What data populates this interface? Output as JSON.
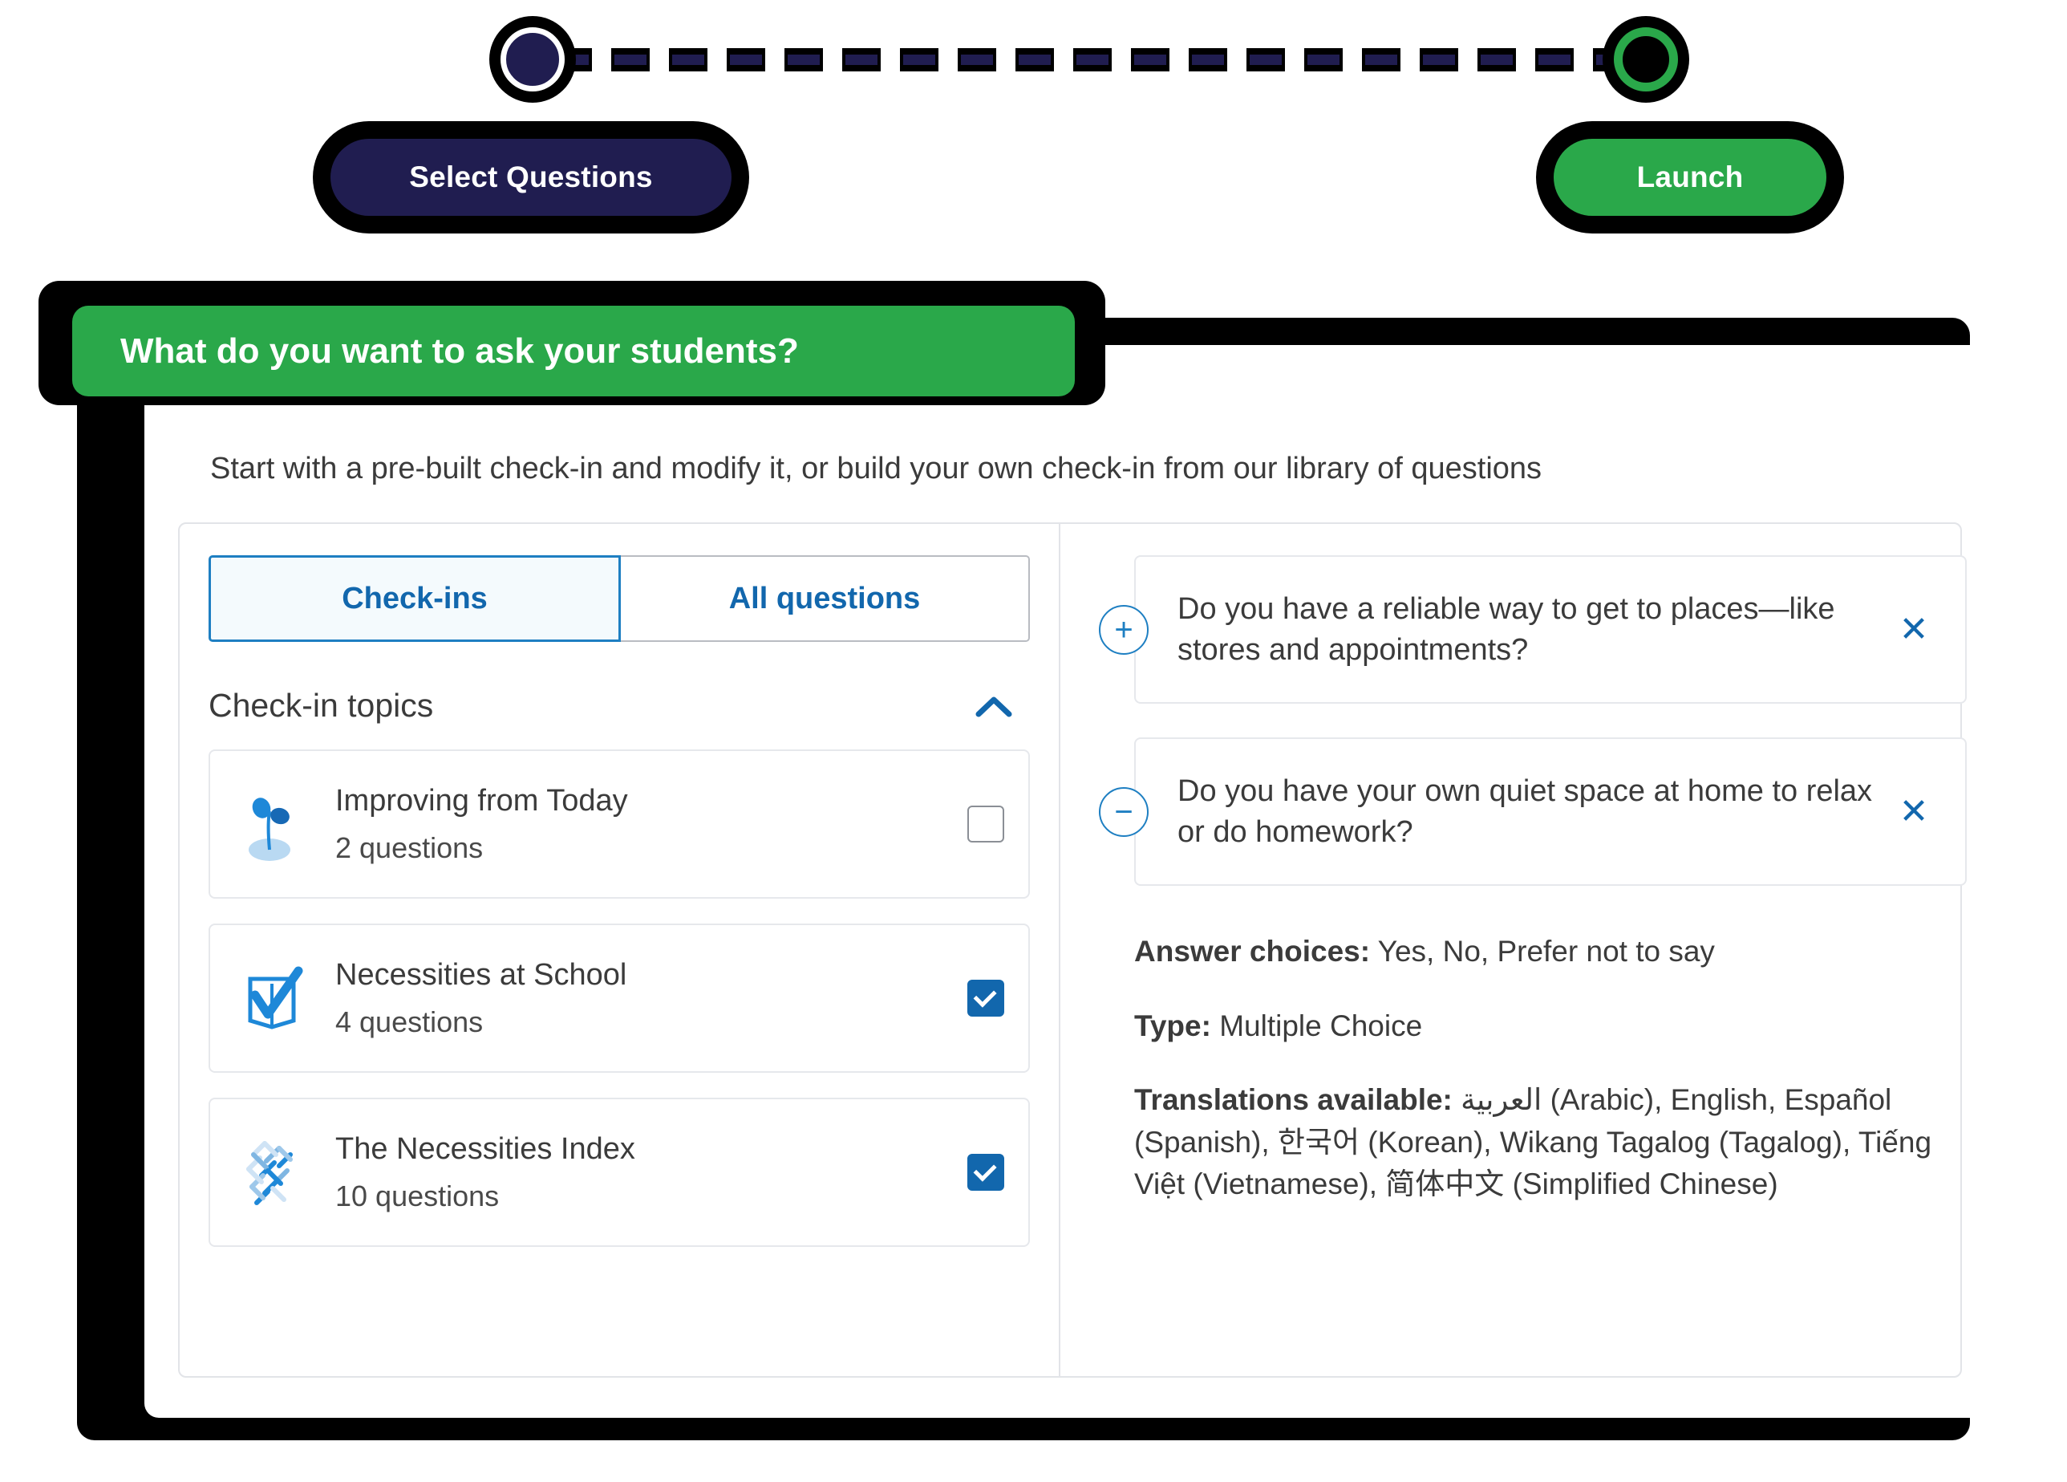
{
  "stepper": {
    "steps": [
      {
        "label": "Select Questions",
        "state": "current",
        "color": "#201d50"
      },
      {
        "label": "Launch",
        "state": "upcoming",
        "color": "#2aa84a"
      }
    ]
  },
  "header": {
    "pill_title": "What do you want to ask your students?",
    "pill_color": "#2aa84a",
    "subtitle": "Start with a pre-built check-in and modify it, or build your own check-in from our library of questions"
  },
  "left_panel": {
    "tabs": [
      {
        "label": "Check-ins",
        "active": true
      },
      {
        "label": "All questions",
        "active": false
      }
    ],
    "section": {
      "label": "Check-in topics",
      "collapse_icon": "chevron-up-icon",
      "expanded": true
    },
    "topics": [
      {
        "icon": "seedling-icon",
        "title": "Improving from Today",
        "count": "2 questions",
        "checked": false
      },
      {
        "icon": "book-check-icon",
        "title": "Necessities at School",
        "count": "4 questions",
        "checked": true
      },
      {
        "icon": "woven-diamond-icon",
        "title": "The Necessities Index",
        "count": "10 questions",
        "checked": true
      }
    ]
  },
  "right_panel": {
    "questions": [
      {
        "toggle_icon": "plus-circle-icon",
        "toggle_glyph": "+",
        "text": "Do you have a reliable way to get to places—like stores and appointments?",
        "close_icon": "close-icon",
        "close_glyph": "✕",
        "expanded": false
      },
      {
        "toggle_icon": "minus-circle-icon",
        "toggle_glyph": "−",
        "text": "Do you have your own quiet space at home to relax or do homework?",
        "close_icon": "close-icon",
        "close_glyph": "✕",
        "expanded": true
      }
    ],
    "detail": {
      "answer_choices_label": "Answer choices:",
      "answer_choices_value": " Yes, No, Prefer not to say",
      "type_label": "Type:",
      "type_value": " Multiple Choice",
      "translations_label": "Translations available:",
      "translations_value": " العربية (Arabic), English, Español (Spanish), 한국어 (Korean), Wikang Tagalog (Tagalog), Tiếng Việt (Vietnamese), 简体中文 (Simplified Chinese)"
    }
  },
  "colors": {
    "navy": "#201d50",
    "green": "#2aa84a",
    "blue": "#1267ad",
    "blue_light": "#1e7fc2",
    "text": "#3b3b3b"
  }
}
